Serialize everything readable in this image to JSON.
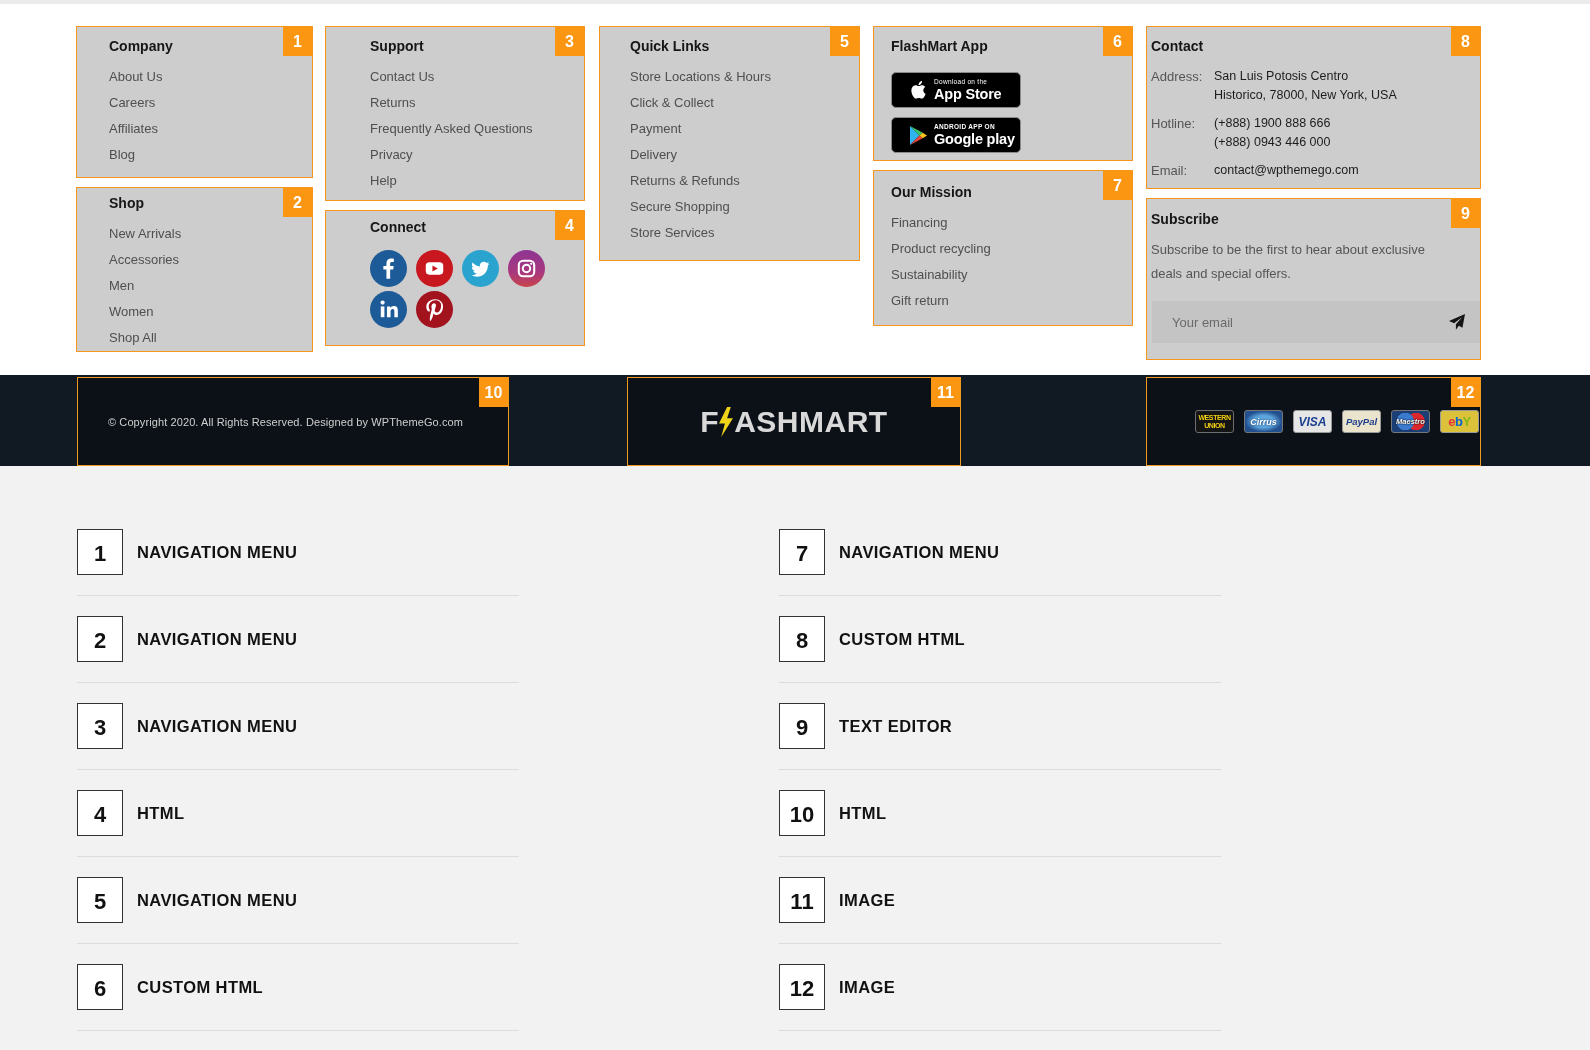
{
  "widgets": {
    "columns": [
      [
        {
          "badge": "1",
          "kind": "menu",
          "title": "Company",
          "items": [
            "About Us",
            "Careers",
            "Affiliates",
            "Blog"
          ]
        },
        {
          "badge": "2",
          "kind": "menu",
          "title": "Shop",
          "items": [
            "New Arrivals",
            "Accessories",
            "Men",
            "Women",
            "Shop All"
          ]
        }
      ],
      [
        {
          "badge": "3",
          "kind": "menu",
          "title": "Support",
          "items": [
            "Contact Us",
            "Returns",
            "Frequently Asked Questions",
            "Privacy",
            "Help"
          ]
        },
        {
          "badge": "4",
          "kind": "social",
          "title": "Connect",
          "icons": [
            {
              "kind": "facebook"
            },
            {
              "kind": "youtube"
            },
            {
              "kind": "twitter"
            },
            {
              "kind": "instagram"
            },
            {
              "kind": "linkedin"
            },
            {
              "kind": "pinterest"
            }
          ]
        }
      ],
      [
        {
          "badge": "5",
          "kind": "menu",
          "title": "Quick Links",
          "items": [
            "Store Locations & Hours",
            "Click & Collect",
            "Payment",
            "Delivery",
            "Returns & Refunds",
            "Secure Shopping",
            "Store Services"
          ]
        }
      ],
      [
        {
          "badge": "6",
          "kind": "apps",
          "title": "FlashMart App",
          "stores": [
            {
              "kind": "app-store",
              "caption": "Download on the",
              "name": "App Store"
            },
            {
              "kind": "google-play",
              "caption": "ANDROID APP ON",
              "name": "Google play"
            }
          ]
        },
        {
          "badge": "7",
          "kind": "menu",
          "title": "Our Mission",
          "items": [
            "Financing",
            "Product recycling",
            "Sustainability",
            "Gift return"
          ]
        }
      ],
      [
        {
          "badge": "8",
          "kind": "contact",
          "title": "Contact",
          "rows": [
            {
              "label": "Address:",
              "lines": [
                "San Luis Potosis Centro",
                "Historico, 78000, New York, USA"
              ]
            },
            {
              "label": "Hotline:",
              "lines": [
                "(+888) 1900 888 666",
                "(+888) 0943 446 000"
              ]
            },
            {
              "label": "Email:",
              "lines": [
                "contact@wpthemego.com"
              ]
            }
          ]
        },
        {
          "badge": "9",
          "kind": "subscribe",
          "title": "Subscribe",
          "text": "Subscribe to be the first to hear about exclusive deals and special offers.",
          "placeholder": "Your email"
        }
      ]
    ]
  },
  "footer_bar": {
    "panels": [
      {
        "badge": "10",
        "kind": "copyright",
        "text": "© Copyright 2020. All Rights Reserved. Designed by WPThemeGo.com"
      },
      {
        "badge": "11",
        "kind": "logo",
        "logo": {
          "start": "F",
          "end": "ASHMART"
        }
      },
      {
        "badge": "12",
        "kind": "payments",
        "cards": [
          {
            "kind": "western-union",
            "label": "WESTERN UNION"
          },
          {
            "kind": "cirrus",
            "label": "Cirrus"
          },
          {
            "kind": "visa",
            "label": "VISA"
          },
          {
            "kind": "paypal",
            "label": "PayPal"
          },
          {
            "kind": "maestro",
            "label": "Maestro"
          },
          {
            "kind": "ebay",
            "label": "ebY"
          }
        ]
      }
    ]
  },
  "widget_legend": {
    "columns": [
      [
        {
          "number": "1",
          "label": "NAVIGATION MENU"
        },
        {
          "number": "2",
          "label": "NAVIGATION MENU"
        },
        {
          "number": "3",
          "label": "NAVIGATION MENU"
        },
        {
          "number": "4",
          "label": "HTML"
        },
        {
          "number": "5",
          "label": "NAVIGATION MENU"
        },
        {
          "number": "6",
          "label": "CUSTOM HTML"
        }
      ],
      [
        {
          "number": "7",
          "label": "NAVIGATION MENU"
        },
        {
          "number": "8",
          "label": "CUSTOM HTML"
        },
        {
          "number": "9",
          "label": "TEXT EDITOR"
        },
        {
          "number": "10",
          "label": "HTML"
        },
        {
          "number": "11",
          "label": "IMAGE"
        },
        {
          "number": "12",
          "label": "IMAGE"
        }
      ]
    ]
  }
}
